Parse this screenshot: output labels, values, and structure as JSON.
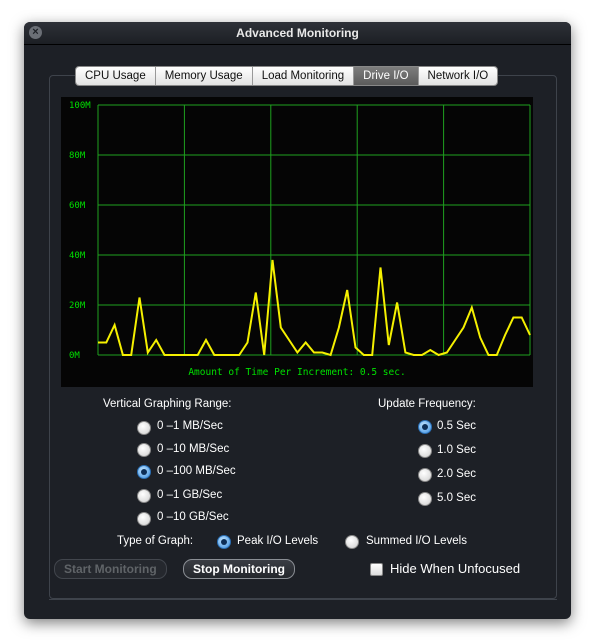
{
  "window": {
    "title": "Advanced Monitoring"
  },
  "tabs": [
    {
      "label": "CPU Usage",
      "active": false
    },
    {
      "label": "Memory Usage",
      "active": false
    },
    {
      "label": "Load Monitoring",
      "active": false
    },
    {
      "label": "Drive I/O",
      "active": true
    },
    {
      "label": "Network I/O",
      "active": false
    }
  ],
  "graph": {
    "y_ticks": [
      "100M",
      "80M",
      "60M",
      "40M",
      "20M",
      "0M"
    ],
    "caption": "Amount of Time Per Increment: 0.5 sec.",
    "colors": {
      "background": "#050505",
      "grid": "#1fa11f",
      "line": "#f5f000"
    },
    "ymax": 100,
    "values": [
      5,
      5,
      12,
      0,
      0,
      23,
      1,
      6,
      0,
      0,
      0,
      0,
      0,
      6,
      0,
      0,
      0,
      0,
      5,
      25,
      0,
      38,
      11,
      6,
      1,
      5,
      1,
      1,
      0,
      11,
      26,
      3,
      0,
      0,
      35,
      4,
      21,
      1,
      0,
      0,
      2,
      0,
      1,
      6,
      11,
      19,
      7,
      0,
      0,
      8,
      15,
      15,
      8
    ]
  },
  "range": {
    "heading": "Vertical Graphing Range:",
    "options": [
      {
        "label": "0 –1 MB/Sec",
        "selected": false
      },
      {
        "label": "0 –10 MB/Sec",
        "selected": false
      },
      {
        "label": "0 –100 MB/Sec",
        "selected": true
      },
      {
        "label": "0 –1 GB/Sec",
        "selected": false
      },
      {
        "label": "0 –10 GB/Sec",
        "selected": false
      }
    ]
  },
  "frequency": {
    "heading": "Update Frequency:",
    "options": [
      {
        "label": "0.5 Sec",
        "selected": true
      },
      {
        "label": "1.0 Sec",
        "selected": false
      },
      {
        "label": "2.0 Sec",
        "selected": false
      },
      {
        "label": "5.0 Sec",
        "selected": false
      }
    ]
  },
  "graph_type": {
    "label": "Type of Graph:",
    "options": [
      {
        "label": "Peak I/O Levels",
        "selected": true
      },
      {
        "label": "Summed I/O Levels",
        "selected": false
      }
    ]
  },
  "buttons": {
    "start": "Start Monitoring",
    "stop": "Stop Monitoring"
  },
  "hide_when_unfocused": {
    "label": "Hide When Unfocused",
    "checked": false
  }
}
